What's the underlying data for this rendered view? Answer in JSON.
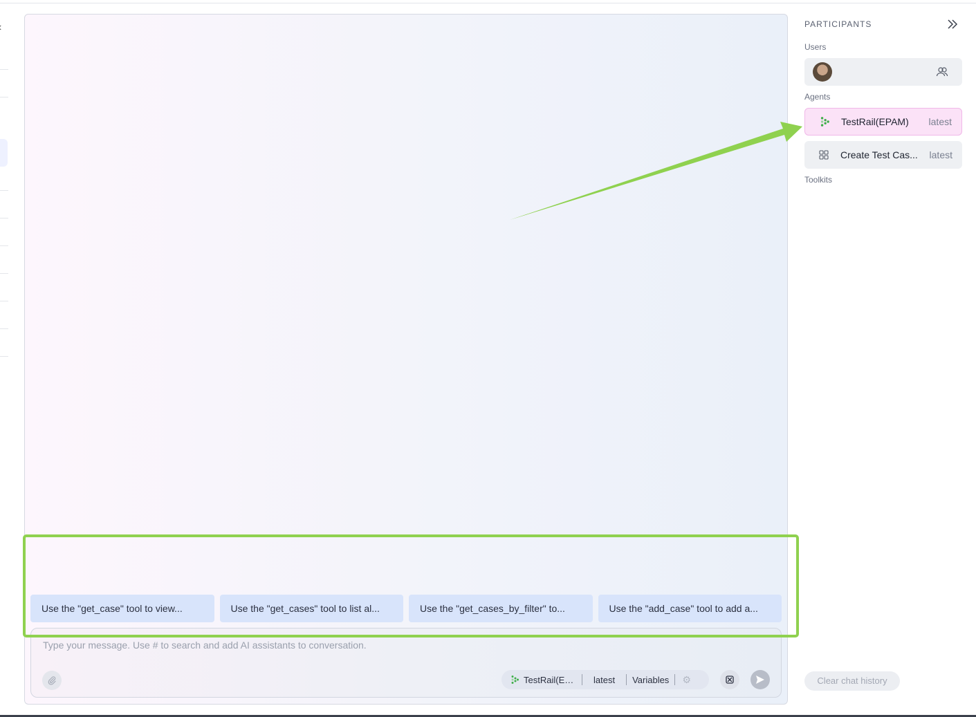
{
  "participants": {
    "title": "PARTICIPANTS",
    "users_label": "Users",
    "agents_label": "Agents",
    "toolkits_label": "Toolkits",
    "agents": [
      {
        "name": "TestRail(EPAM)",
        "version": "latest",
        "icon": "testrail-icon",
        "selected": true
      },
      {
        "name": "Create Test Cas...",
        "version": "latest",
        "icon": "grid-icon",
        "selected": false
      }
    ],
    "clear_history_label": "Clear chat history"
  },
  "chat": {
    "suggestions": [
      "Use the \"get_case\" tool to view...",
      "Use the \"get_cases\" tool to list al...",
      "Use the \"get_cases_by_filter\" to...",
      "Use the \"add_case\" tool to add a..."
    ],
    "input_placeholder": "Type your message. Use # to search and add AI assistants to conversation.",
    "selected_agent": "TestRail(EP...",
    "selected_version": "latest",
    "variables_label": "Variables"
  },
  "colors": {
    "annotation_green": "#8fd14f",
    "agent_selected_bg": "#fbe2f7",
    "suggestion_bg": "#d8e4fb"
  }
}
